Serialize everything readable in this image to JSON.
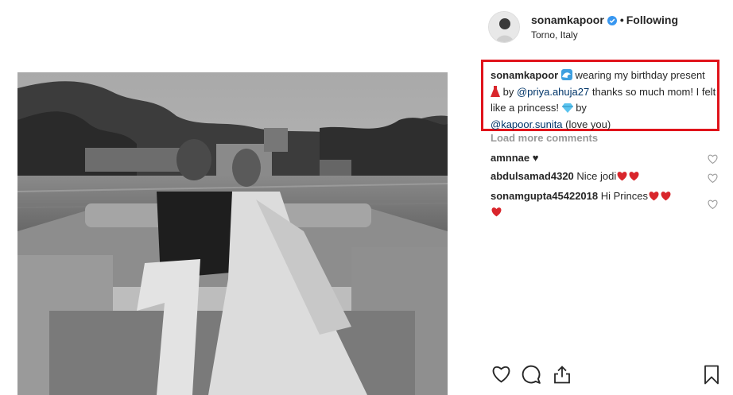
{
  "post": {
    "username": "sonamkapoor",
    "separator": "•",
    "follow_label": "Following",
    "location": "Torno, Italy"
  },
  "caption": {
    "username": "sonamkapoor",
    "text1": " wearing my birthday present ",
    "text2": " by ",
    "mention1": "@priya.ahuja27",
    "text3": " thanks so much mom! I felt like a princess! ",
    "text4": " by ",
    "mention2": "@kapoor.sunita",
    "text5": " (love you)",
    "highlight_color": "#e0131b"
  },
  "load_more_label": "Load more comments",
  "comments": [
    {
      "user": "amnnae",
      "text": "♥"
    },
    {
      "user": "abdulsamad4320",
      "text": "Nice jodi"
    },
    {
      "user": "sonamgupta45422018",
      "text": "Hi Princes"
    }
  ],
  "icons": [
    "verified-badge-icon",
    "heart-icon",
    "comment-icon",
    "share-icon",
    "bookmark-icon",
    "wave-emoji-icon",
    "dress-emoji-icon",
    "gem-emoji-icon"
  ]
}
